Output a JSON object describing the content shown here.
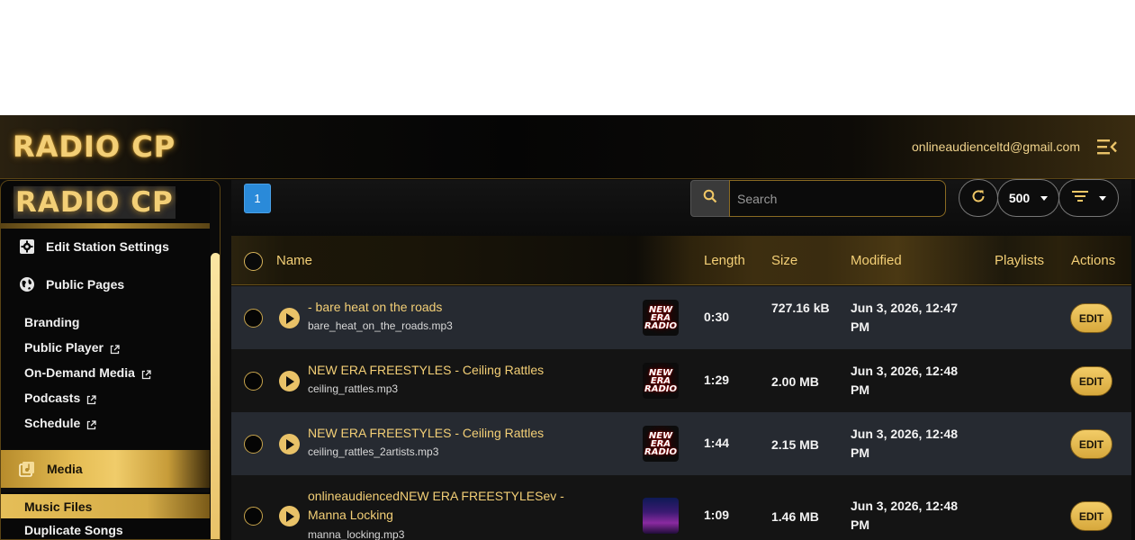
{
  "header": {
    "brand": "RADIO CP",
    "user_email": "onlineaudienceltd@gmail.com"
  },
  "sidebar": {
    "brand": "RADIO CP",
    "items": [
      {
        "label": "Edit Station Settings",
        "icon": "gear-icon"
      },
      {
        "label": "Public Pages",
        "icon": "globe-icon"
      }
    ],
    "public_pages": [
      {
        "label": "Branding",
        "external": false
      },
      {
        "label": "Public Player",
        "external": true
      },
      {
        "label": "On-Demand Media",
        "external": true
      },
      {
        "label": "Podcasts",
        "external": true
      },
      {
        "label": "Schedule",
        "external": true
      }
    ],
    "media": {
      "label": "Media",
      "icon": "media-library-icon"
    },
    "media_sub": {
      "active": "Music Files",
      "next": "Duplicate Songs"
    }
  },
  "toolbar": {
    "page": "1",
    "search_placeholder": "Search",
    "per_page": "500"
  },
  "table": {
    "columns": [
      "Name",
      "Length",
      "Size",
      "Modified",
      "Playlists",
      "Actions"
    ],
    "rows": [
      {
        "title": "- bare heat on the roads",
        "file": "bare_heat_on_the_roads.mp3",
        "art": "NEW ERA RADIO",
        "length": "0:30",
        "size": "727.16 kB",
        "modified": "Jun 3, 2026, 12:47 PM",
        "action": "EDIT"
      },
      {
        "title": "NEW ERA FREESTYLES - Ceiling Rattles",
        "file": "ceiling_rattles.mp3",
        "art": "NEW ERA RADIO",
        "length": "1:29",
        "size": "2.00 MB",
        "modified": "Jun 3, 2026, 12:48 PM",
        "action": "EDIT"
      },
      {
        "title": "NEW ERA FREESTYLES - Ceiling Rattles",
        "file": "ceiling_rattles_2artists.mp3",
        "art": "NEW ERA RADIO",
        "length": "1:44",
        "size": "2.15 MB",
        "modified": "Jun 3, 2026, 12:48 PM",
        "action": "EDIT"
      },
      {
        "title": "onlineaudiencedNEW ERA FREESTYLESev - Manna Locking",
        "file": "manna_locking.mp3",
        "art": "",
        "length": "1:09",
        "size": "1.46 MB",
        "modified": "Jun 3, 2026, 12:48 PM",
        "action": "EDIT"
      }
    ]
  },
  "colors": {
    "accent": "#e9c268",
    "page_button": "#2a8ad9",
    "row_alt": "#262a31"
  }
}
